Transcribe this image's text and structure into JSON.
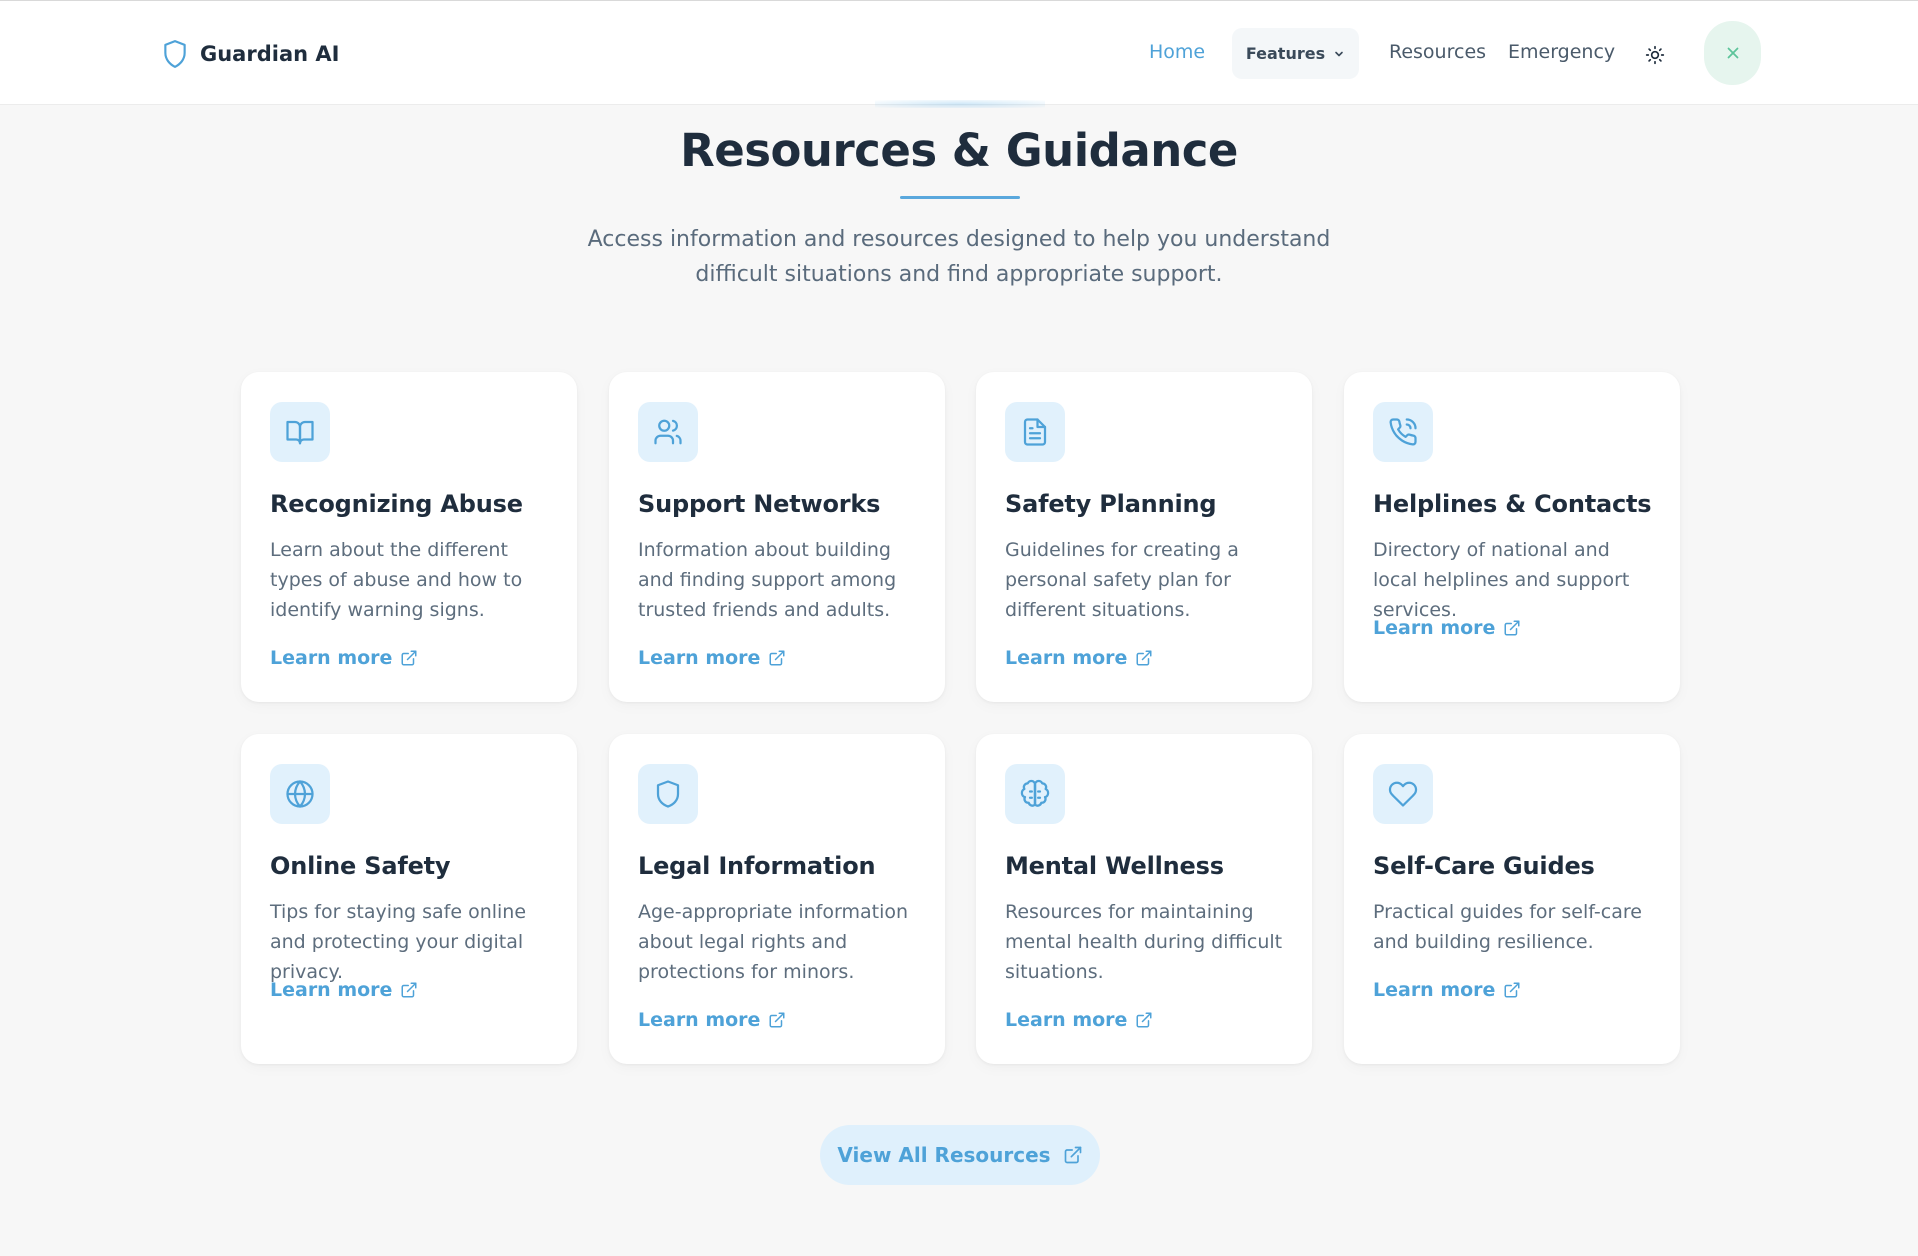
{
  "brand": {
    "name": "Guardian AI"
  },
  "nav": {
    "home": "Home",
    "features": "Features",
    "resources": "Resources",
    "emergency": "Emergency"
  },
  "section": {
    "title": "Resources & Guidance",
    "subtitle": "Access information and resources designed to help you understand difficult situations and find appropriate support."
  },
  "cards": [
    {
      "icon": "book-open-icon",
      "title": "Recognizing Abuse",
      "description": "Learn about the different types of abuse and how to identify warning signs.",
      "link": "Learn more"
    },
    {
      "icon": "users-icon",
      "title": "Support Networks",
      "description": "Information about building and finding support among trusted friends and adults.",
      "link": "Learn more"
    },
    {
      "icon": "file-text-icon",
      "title": "Safety Planning",
      "description": "Guidelines for creating a personal safety plan for different situations.",
      "link": "Learn more"
    },
    {
      "icon": "phone-call-icon",
      "title": "Helplines & Contacts",
      "description": "Directory of national and local helplines and support services.",
      "link": "Learn more"
    },
    {
      "icon": "globe-icon",
      "title": "Online Safety",
      "description": "Tips for staying safe online and protecting your digital privacy.",
      "link": "Learn more"
    },
    {
      "icon": "shield-icon",
      "title": "Legal Information",
      "description": "Age-appropriate information about legal rights and protections for minors.",
      "link": "Learn more"
    },
    {
      "icon": "brain-icon",
      "title": "Mental Wellness",
      "description": "Resources for maintaining mental health during difficult situations.",
      "link": "Learn more"
    },
    {
      "icon": "heart-icon",
      "title": "Self-Care Guides",
      "description": "Practical guides for self-care and building resilience.",
      "link": "Learn more"
    }
  ],
  "view_all": "View All Resources",
  "colors": {
    "accent": "#4ea2d8",
    "icon_bg": "#e1f1fc",
    "close_bg": "#e6f5ee",
    "background": "#f7f7f7"
  }
}
